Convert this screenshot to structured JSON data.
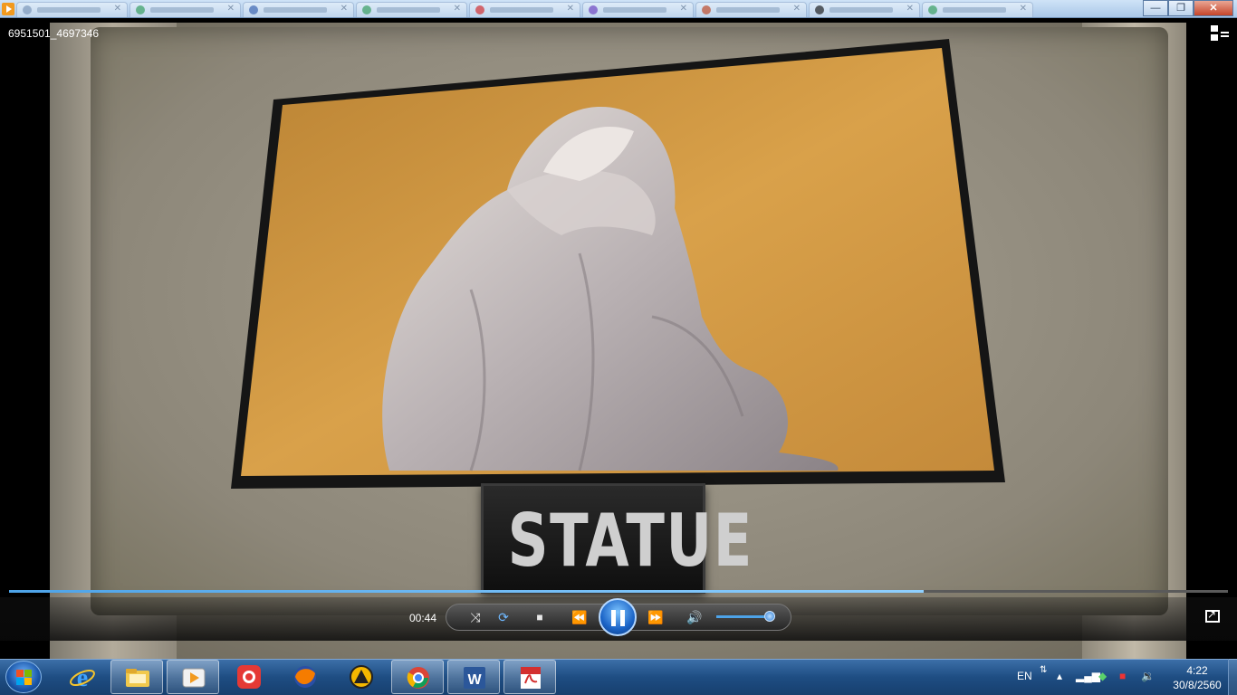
{
  "window": {
    "title_left": "6951501_4697346",
    "buttons": [
      "—",
      "❐",
      "✕"
    ]
  },
  "video": {
    "plaque_text": "STATUE"
  },
  "player": {
    "time": "00:44",
    "progress_fraction": 0.75,
    "volume_fraction": 0.95
  },
  "taskbar": {
    "language": "EN",
    "clock_time": "4:22",
    "clock_date": "30/8/2560",
    "apps": [
      "internet-explorer",
      "file-explorer",
      "media-player",
      "app-red",
      "firefox",
      "app-yellow",
      "chrome",
      "word",
      "acrobat"
    ]
  },
  "colors": {
    "frame_bg": "#d79a3c",
    "accent": "#3e8ee6"
  }
}
